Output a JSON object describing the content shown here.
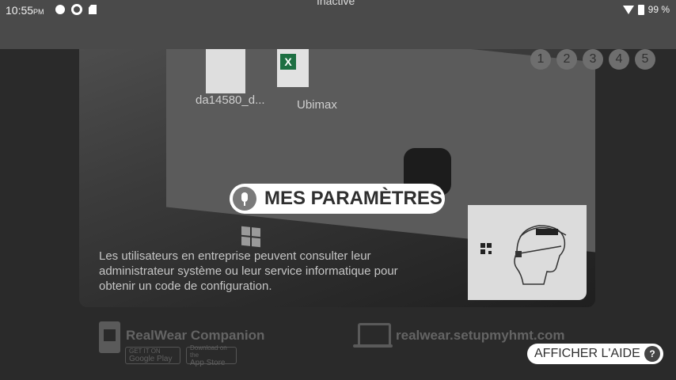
{
  "status_bar": {
    "time": "10:55",
    "ampm": "PM",
    "center_text": "Inactive",
    "battery": "99 %"
  },
  "background_photo": {
    "desktop_labels": [
      "da14580_d...",
      "Ubimax"
    ]
  },
  "pagination": [
    "1",
    "2",
    "3",
    "4",
    "5"
  ],
  "title": "MES PARAMÈTRES",
  "description": "Les utilisateurs en entreprise peuvent consulter leur administrateur système ou leur service informatique pour obtenir un code de configuration.",
  "companion": {
    "title": "RealWear Companion",
    "google_play_small": "GET IT ON",
    "google_play": "Google Play",
    "app_store_small": "Download on the",
    "app_store": "App Store"
  },
  "web": {
    "url": "realwear.setupmyhmt.com"
  },
  "help": {
    "label": "AFFICHER L'AIDE",
    "icon": "?"
  },
  "colors": {
    "status_bar_bg": "#4a4a4a",
    "background": "#2a2a2a",
    "pill": "#ffffff"
  }
}
